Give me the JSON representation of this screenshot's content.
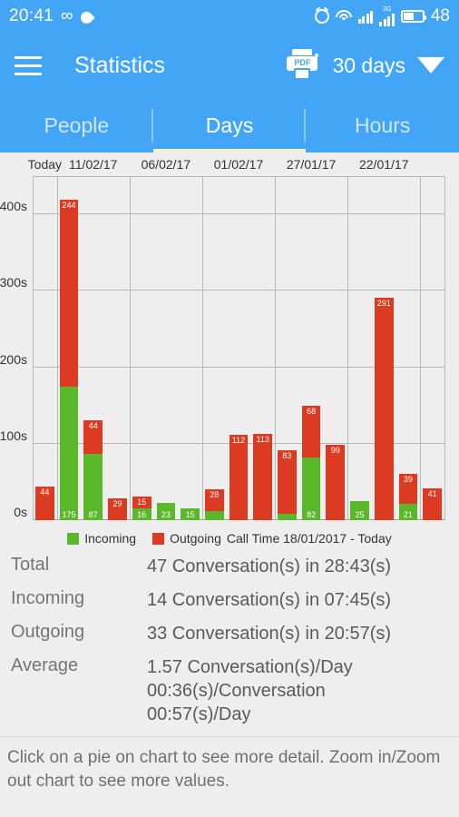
{
  "statusbar": {
    "time": "20:41",
    "infinity_icon": "infinity-icon",
    "drop_icon": "water-drop-icon",
    "alarm_icon": "alarm-icon",
    "wifi_icon": "wifi-icon",
    "signal_icon": "signal-bars-icon",
    "network_type": "3G",
    "battery_icon": "battery-icon",
    "battery_level": "48"
  },
  "appbar": {
    "menu_icon": "hamburger-menu-icon",
    "title": "Statistics",
    "pdf_icon": "pdf-print-icon",
    "pdf_icon_text": "PDF",
    "range_label": "30 days",
    "caret_icon": "caret-down-icon"
  },
  "tabs": [
    {
      "label": "People",
      "active": false
    },
    {
      "label": "Days",
      "active": true
    },
    {
      "label": "Hours",
      "active": false
    }
  ],
  "chart_data": {
    "type": "bar",
    "title": "Call Time 18/01/2017 - Today",
    "stacked": true,
    "xlabel": "",
    "ylabel": "",
    "ylim": [
      0,
      450
    ],
    "yticks": [
      0,
      100,
      200,
      300,
      400
    ],
    "ytick_labels": [
      "0s",
      "100s",
      "200s",
      "300s",
      "400s"
    ],
    "grid": true,
    "legend_position": "bottom",
    "series": [
      {
        "name": "Incoming",
        "color": "#5cb82b"
      },
      {
        "name": "Outgoing",
        "color": "#dd3b21"
      }
    ],
    "xtick_labels": [
      "Today",
      "11/02/17",
      "06/02/17",
      "01/02/17",
      "27/01/17",
      "22/01/17"
    ],
    "bars": [
      {
        "index": 0,
        "incoming": 0,
        "outgoing": 44,
        "incoming_label": "0",
        "outgoing_label": "44"
      },
      {
        "index": 1,
        "incoming": 175,
        "outgoing": 244,
        "incoming_label": "175",
        "outgoing_label": "244"
      },
      {
        "index": 2,
        "incoming": 87,
        "outgoing": 44,
        "incoming_label": "87",
        "outgoing_label": "44"
      },
      {
        "index": 3,
        "incoming": 0,
        "outgoing": 29,
        "incoming_label": "0",
        "outgoing_label": "29"
      },
      {
        "index": 4,
        "incoming": 16,
        "outgoing": 15,
        "incoming_label": "16",
        "outgoing_label": "15"
      },
      {
        "index": 5,
        "incoming": 23,
        "outgoing": 0,
        "incoming_label": "23",
        "outgoing_label": ""
      },
      {
        "index": 6,
        "incoming": 15,
        "outgoing": 0,
        "incoming_label": "15",
        "outgoing_label": ""
      },
      {
        "index": 7,
        "incoming": 12,
        "outgoing": 28,
        "incoming_label": "",
        "outgoing_label": "28"
      },
      {
        "index": 8,
        "incoming": 0,
        "outgoing": 112,
        "incoming_label": "0",
        "outgoing_label": "112"
      },
      {
        "index": 9,
        "incoming": 0,
        "outgoing": 113,
        "incoming_label": "0",
        "outgoing_label": "113"
      },
      {
        "index": 10,
        "incoming": 8,
        "outgoing": 83,
        "incoming_label": "",
        "outgoing_label": "83"
      },
      {
        "index": 11,
        "incoming": 82,
        "outgoing": 68,
        "incoming_label": "82",
        "outgoing_label": "68"
      },
      {
        "index": 12,
        "incoming": 0,
        "outgoing": 99,
        "incoming_label": "0",
        "outgoing_label": "99"
      },
      {
        "index": 13,
        "incoming": 25,
        "outgoing": 0,
        "incoming_label": "25",
        "outgoing_label": ""
      },
      {
        "index": 14,
        "incoming": 0,
        "outgoing": 291,
        "incoming_label": "0",
        "outgoing_label": "291"
      },
      {
        "index": 15,
        "incoming": 21,
        "outgoing": 39,
        "incoming_label": "21",
        "outgoing_label": "39"
      },
      {
        "index": 16,
        "incoming": 0,
        "outgoing": 41,
        "incoming_label": "0",
        "outgoing_label": "41"
      }
    ]
  },
  "legend": {
    "incoming": "Incoming",
    "outgoing": "Outgoing",
    "caption": "Call Time 18/01/2017 - Today"
  },
  "summary": [
    {
      "label": "Total",
      "value": "47 Conversation(s) in 28:43(s)"
    },
    {
      "label": "Incoming",
      "value": "14 Conversation(s) in 07:45(s)"
    },
    {
      "label": "Outgoing",
      "value": "33 Conversation(s) in 20:57(s)"
    },
    {
      "label": "Average",
      "value": "1.57 Conversation(s)/Day\n00:36(s)/Conversation\n00:57(s)/Day"
    }
  ],
  "footnote": "Click on a pie on chart to see more detail. Zoom in/Zoom out chart to see more values.",
  "colors": {
    "accent": "#42a5f5",
    "incoming": "#5cb82b",
    "outgoing": "#dd3b21",
    "tab_indicator": "#f5f3cf",
    "background": "#eeeeee"
  }
}
